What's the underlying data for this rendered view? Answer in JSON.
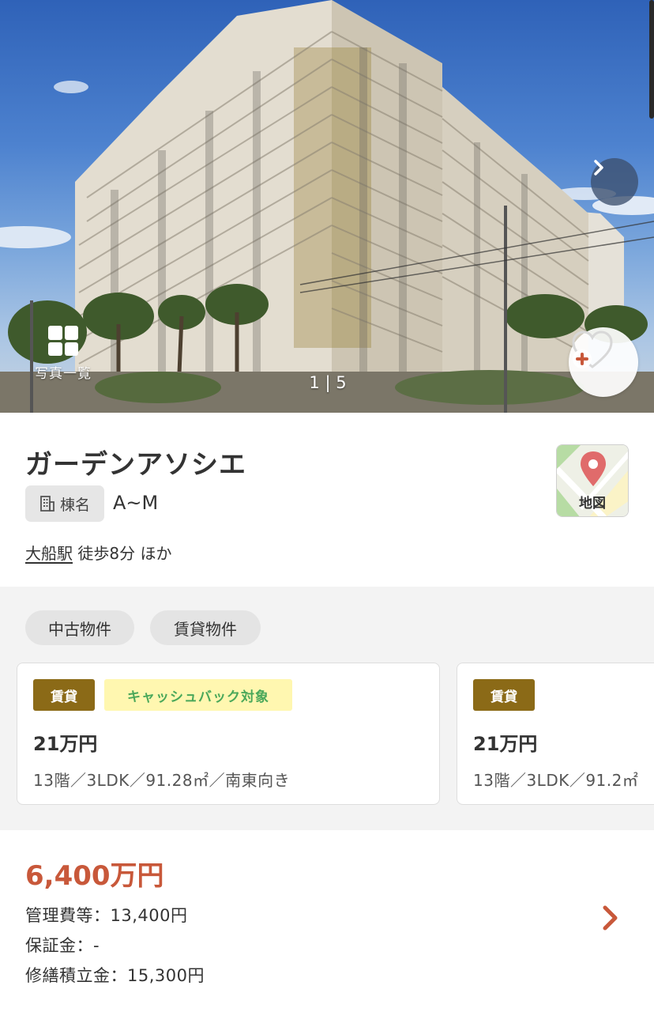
{
  "hero": {
    "photo_list_label": "写真一覧",
    "counter": "1 | 5",
    "colors": {
      "sky": "#3b6fc2",
      "facade": "#ddd6c8",
      "accent_band": "#b9a878"
    }
  },
  "property": {
    "name": "ガーデンアソシエ",
    "building_label": "棟名",
    "building_value": "A~M",
    "station": "大船駅",
    "access": "徒歩8分 ほか",
    "map_label": "地図"
  },
  "tabs": [
    "中古物件",
    "賃貸物件"
  ],
  "listings": [
    {
      "badge": "賃貸",
      "tag": "キャッシュバック対象",
      "price": "21万円",
      "spec": "13階／3LDK／91.28㎡／南東向き"
    },
    {
      "badge": "賃貸",
      "price": "21万円",
      "spec": "13階／3LDK／91.2㎡"
    }
  ],
  "sale": {
    "price": "6,400万円",
    "fees": [
      "管理費等：13,400円",
      "保証金：-",
      "修繕積立金：15,300円"
    ]
  },
  "colors": {
    "accent_red": "#c8583a",
    "rent_badge": "#8b6a17",
    "cashback_bg": "#fff7b0",
    "cashback_text": "#4aa85a",
    "section_grey": "#f3f3f3"
  }
}
